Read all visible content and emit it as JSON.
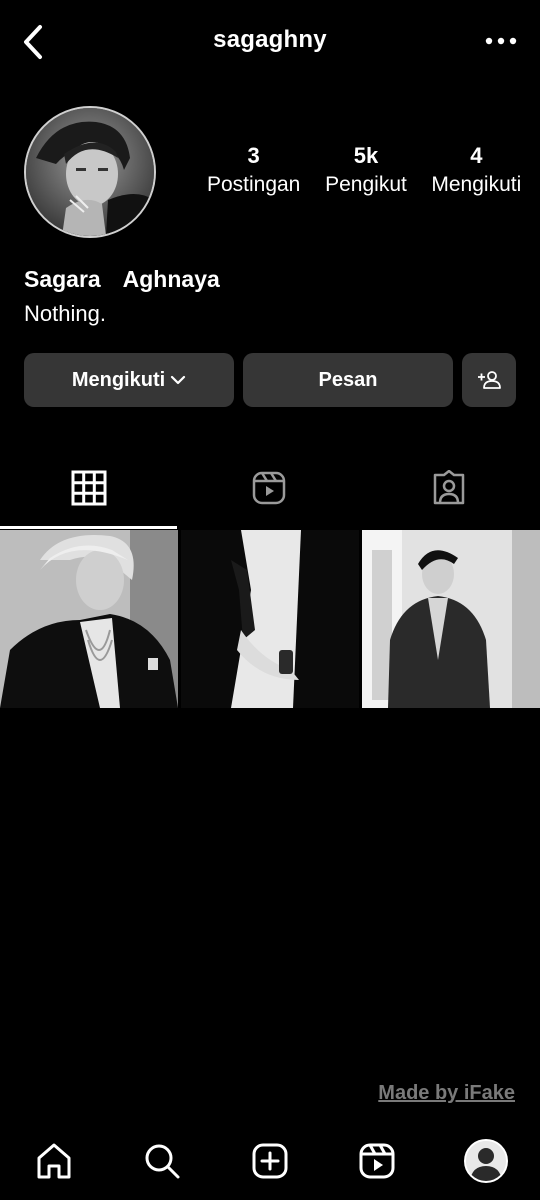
{
  "header": {
    "username": "sagaghny",
    "back_icon": "chevron-left-icon",
    "more_icon": "more-horizontal-icon"
  },
  "profile": {
    "stats": {
      "posts": {
        "count": "3",
        "label": "Postingan"
      },
      "followers": {
        "count": "5k",
        "label": "Pengikut"
      },
      "following": {
        "count": "4",
        "label": "Mengikuti"
      }
    },
    "full_name": "Sagara  Aghnaya",
    "bio": "Nothing."
  },
  "actions": {
    "following_label": "Mengikuti",
    "message_label": "Pesan",
    "suggest_icon": "add-person-icon"
  },
  "tabs": [
    {
      "name": "grid",
      "icon": "grid-icon",
      "active": true
    },
    {
      "name": "reels",
      "icon": "reels-icon",
      "active": false
    },
    {
      "name": "tagged",
      "icon": "tagged-icon",
      "active": false
    }
  ],
  "posts": [
    {
      "description": ""
    },
    {
      "description": ""
    },
    {
      "description": ""
    }
  ],
  "watermark": "Made by iFake",
  "bottom_nav": [
    "home-icon",
    "search-icon",
    "create-icon",
    "reels-icon",
    "profile-avatar"
  ],
  "colors": {
    "background": "#000000",
    "button_bg": "#363636",
    "text": "#ffffff",
    "watermark": "#7a7a7a"
  }
}
